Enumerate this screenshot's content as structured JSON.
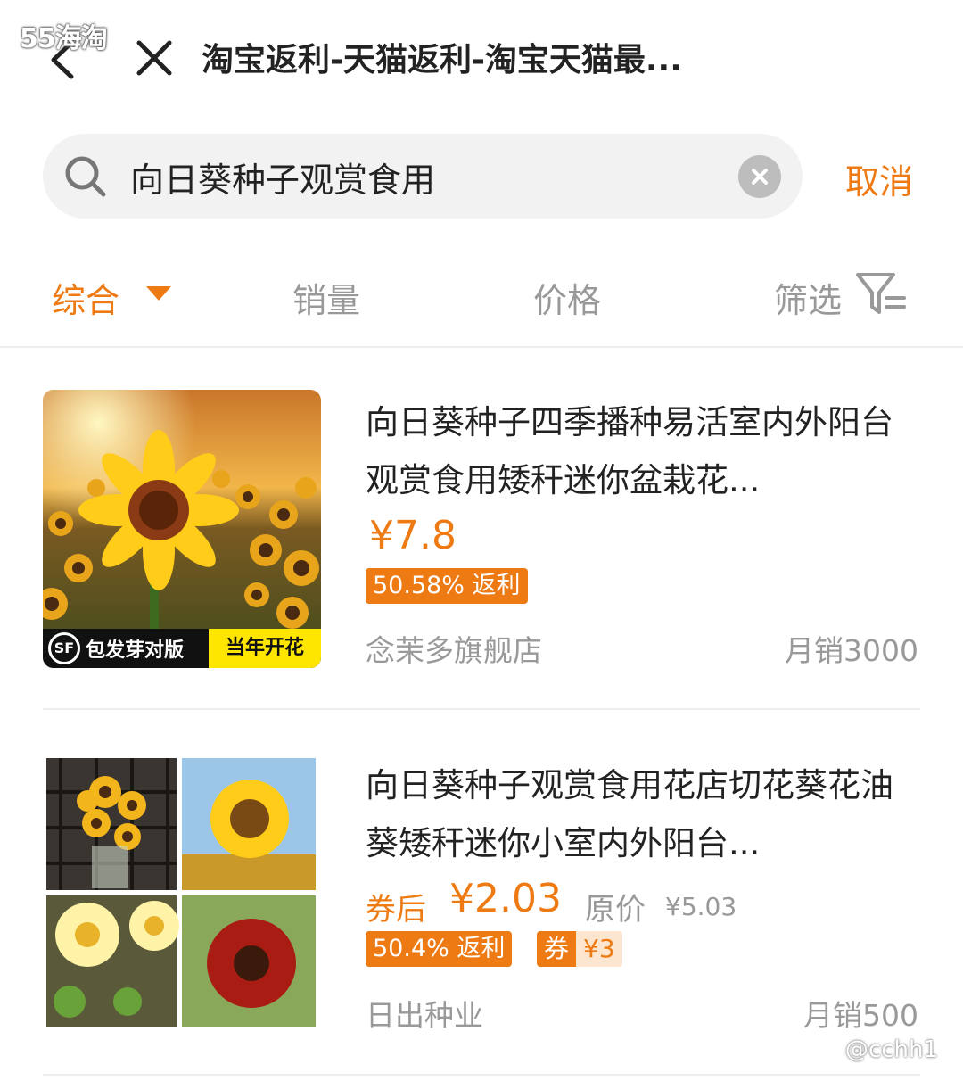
{
  "watermark": {
    "top_left": "55海淘",
    "bottom_right": "@cchh1"
  },
  "header": {
    "title": "淘宝返利-天猫返利-淘宝天猫最...",
    "back_icon": "chevron-left-icon",
    "close_icon": "close-icon"
  },
  "search": {
    "value": "向日葵种子观赏食用",
    "icon": "search-icon",
    "clear_icon": "clear-icon",
    "cancel_label": "取消"
  },
  "sort": {
    "tabs": [
      {
        "label": "综合",
        "active": true
      },
      {
        "label": "销量",
        "active": false
      },
      {
        "label": "价格",
        "active": false
      },
      {
        "label": "筛选",
        "active": false
      }
    ]
  },
  "products": [
    {
      "title": "向日葵种子四季播种易活室内外阳台观赏食用矮秆迷你盆栽花...",
      "price": "¥7.8",
      "rebate": "50.58% 返利",
      "shop": "念茉多旗舰店",
      "sales": "月销3000",
      "badge_logo": "SF",
      "badge_left": "包发芽对版",
      "badge_right": "当年开花"
    },
    {
      "title": "向日葵种子观赏食用花店切花葵花油葵矮秆迷你小室内外阳台...",
      "price_label": "券后",
      "price": "¥2.03",
      "orig_label": "原价",
      "orig_price": "¥5.03",
      "rebate": "50.4% 返利",
      "coupon_tag": "券",
      "coupon_value": "¥3",
      "shop": "日出种业",
      "sales": "月销500"
    }
  ],
  "colors": {
    "accent": "#ee7a14",
    "muted": "#999999"
  }
}
